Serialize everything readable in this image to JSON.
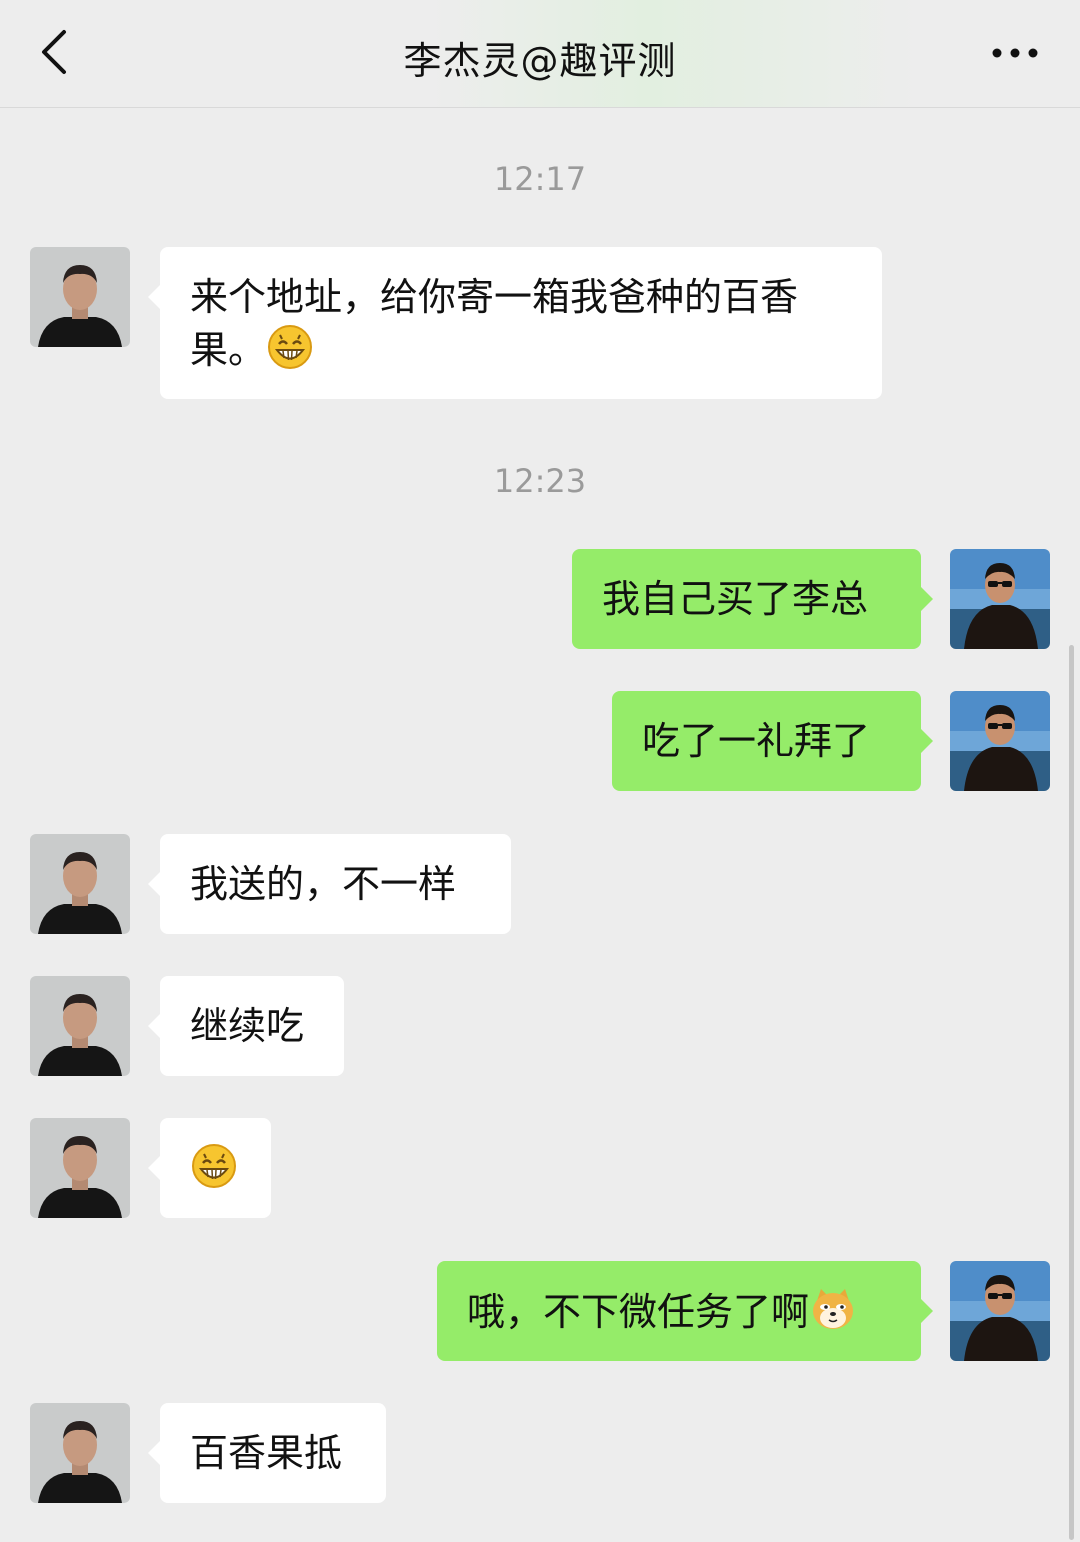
{
  "header": {
    "title": "李杰灵@趣评测"
  },
  "timestamps": [
    "12:17",
    "12:23"
  ],
  "messages": [
    {
      "text": "来个地址，给你寄一箱我爸种的百香",
      "text2": "果。",
      "emoji": "grin-emoji"
    },
    {
      "text": "我自己买了李总"
    },
    {
      "text": "吃了一礼拜了"
    },
    {
      "text": "我送的，不一样"
    },
    {
      "text": "继续吃"
    },
    {
      "emoji": "grin-emoji"
    },
    {
      "text": "哦，不下微任务了啊",
      "emoji": "doge-emoji"
    },
    {
      "text": "百香果抵"
    }
  ],
  "colors": {
    "background": "#ededed",
    "bubble_out": "#95ec69",
    "bubble_in": "#ffffff",
    "timestamp": "#9a9a9a"
  }
}
